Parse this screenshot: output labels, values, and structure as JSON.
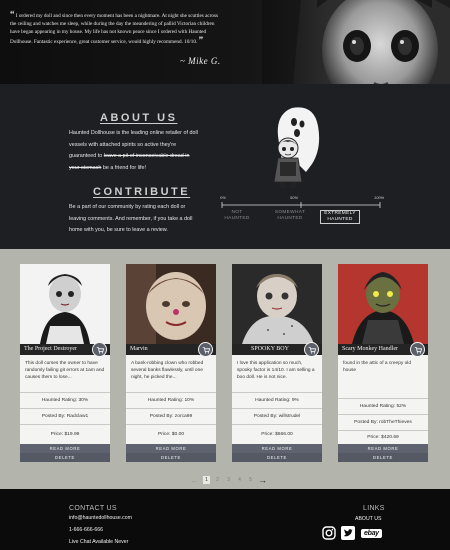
{
  "hero": {
    "quote": "I ordered my doll and since then every moment has been a nightmare. At night she scuttles across the ceiling and watches me sleep, while during the day the meandering of pallid Victorian children have began appearing in my house. My life has not known peace since I ordered with Haunted Dollhouse. Fantastic experience, great customer service, would highly recommend. 10/10.",
    "open_quote": "“",
    "close_quote": "”",
    "author": "~ Mike G."
  },
  "about": {
    "title": "ABOUT US",
    "text_before": "Haunted Dollhouse is the leading online retailer of doll vessels with attached spirits so active they're guaranteed to ",
    "text_struck": "leave a pit of inconceivable dread in your stomach",
    "text_after": " be a friend for life!"
  },
  "contribute": {
    "title": "CONTRIBUTE",
    "text": "Be a part of our community by rating each doll or leaving comments. And remember, if you take a doll home with you, be sure to leave a review."
  },
  "scale": {
    "ticks": [
      "0%",
      "50%",
      "100%"
    ],
    "labels": [
      "NOT HAUNTED",
      "SOMEWHAT HAUNTED",
      "EXTREMELY HAUNTED"
    ]
  },
  "products": [
    {
      "name": "The Project Destroyer",
      "desc": "This doll curses the owner to have randomly failing git errors at 1am and causes them to lose...",
      "rating": "Haunted Rating: 30%",
      "poster": "Posted By: Radclaw1",
      "price": "Price: $19.99",
      "read_more": "READ MORE",
      "delete": "DELETE"
    },
    {
      "name": "Marvin",
      "desc": "A bank-robbing clown who robbed several banks flawlessly, until one night, he picked the...",
      "rating": "Haunted Rating: 10%",
      "poster": "Posted By: zorca99",
      "price": "Price: $0.00",
      "read_more": "READ MORE",
      "delete": "DELETE"
    },
    {
      "name": "SPOOKY BOY",
      "desc": "I love this application so much, spooky factor is 14/10. I am selling a boo doll. He is not nice.",
      "rating": "Haunted Rating: 9%",
      "poster": "Posted By: willstrudel",
      "price": "Price: $666.00",
      "read_more": "READ MORE",
      "delete": "DELETE"
    },
    {
      "name": "Scary Monkey Handler",
      "desc": "found in the attic of a creepy old house",
      "rating": "Haunted Rating: 52%",
      "poster": "Posted By: robTheThieves",
      "price": "Price: $420.69",
      "read_more": "READ MORE",
      "delete": "DELETE"
    }
  ],
  "pagination": {
    "pages": [
      "1",
      "2",
      "3",
      "4",
      "5"
    ],
    "active": "1",
    "prev_icon": "arrow-left-icon",
    "next_icon": "arrow-right-icon"
  },
  "footer": {
    "contact_title": "CONTACT US",
    "email": "info@hauntedollhouse.com",
    "phone": "1-666-666-666",
    "chat": "Live Chat Available Never",
    "links_title": "LINKS",
    "about_link": "ABOUT US",
    "ebay": "ebay",
    "social_icons": [
      "instagram-icon",
      "twitter-icon",
      "ebay-icon"
    ]
  },
  "colors": {
    "dark_bg": "#1d1f23",
    "product_bg": "#b3b4ac",
    "button": "#5f6370",
    "footer_bg": "#0b0b0c"
  }
}
